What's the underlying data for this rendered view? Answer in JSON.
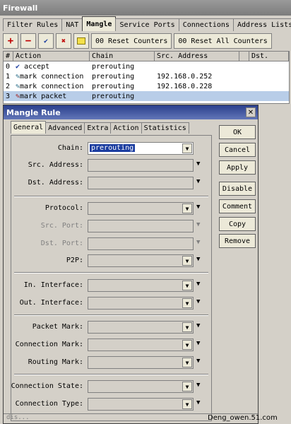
{
  "window": {
    "title": "Firewall"
  },
  "main_tabs": [
    {
      "label": "Filter Rules"
    },
    {
      "label": "NAT"
    },
    {
      "label": "Mangle"
    },
    {
      "label": "Service Ports"
    },
    {
      "label": "Connections"
    },
    {
      "label": "Address Lists"
    }
  ],
  "toolbar": {
    "reset_counters": "00 Reset Counters",
    "reset_all_counters": "00 Reset All Counters"
  },
  "table": {
    "headers": [
      "#",
      "Action",
      "Chain",
      "Src. Address",
      "",
      "Dst."
    ],
    "rows": [
      {
        "num": "0",
        "action": "accept",
        "chain": "prerouting",
        "src": ""
      },
      {
        "num": "1",
        "action": "mark connection",
        "chain": "prerouting",
        "src": "192.168.0.252"
      },
      {
        "num": "2",
        "action": "mark connection",
        "chain": "prerouting",
        "src": "192.168.0.228"
      },
      {
        "num": "3",
        "action": "mark packet",
        "chain": "prerouting",
        "src": ""
      }
    ]
  },
  "dialog": {
    "title": "Mangle Rule",
    "tabs": [
      "General",
      "Advanced",
      "Extra",
      "Action",
      "Statistics"
    ],
    "fields": {
      "chain_label": "Chain:",
      "chain_value": "prerouting",
      "src_address": "Src. Address:",
      "dst_address": "Dst. Address:",
      "protocol": "Protocol:",
      "src_port": "Src. Port:",
      "dst_port": "Dst. Port:",
      "p2p": "P2P:",
      "in_interface": "In. Interface:",
      "out_interface": "Out. Interface:",
      "packet_mark": "Packet Mark:",
      "connection_mark": "Connection Mark:",
      "routing_mark": "Routing Mark:",
      "connection_state": "Connection State:",
      "connection_type": "Connection Type:"
    },
    "buttons": {
      "ok": "OK",
      "cancel": "Cancel",
      "apply": "Apply",
      "disable": "Disable",
      "comment": "Comment",
      "copy": "Copy",
      "remove": "Remove"
    },
    "status": "dis..."
  },
  "watermark": "Deng_owen.51.com"
}
